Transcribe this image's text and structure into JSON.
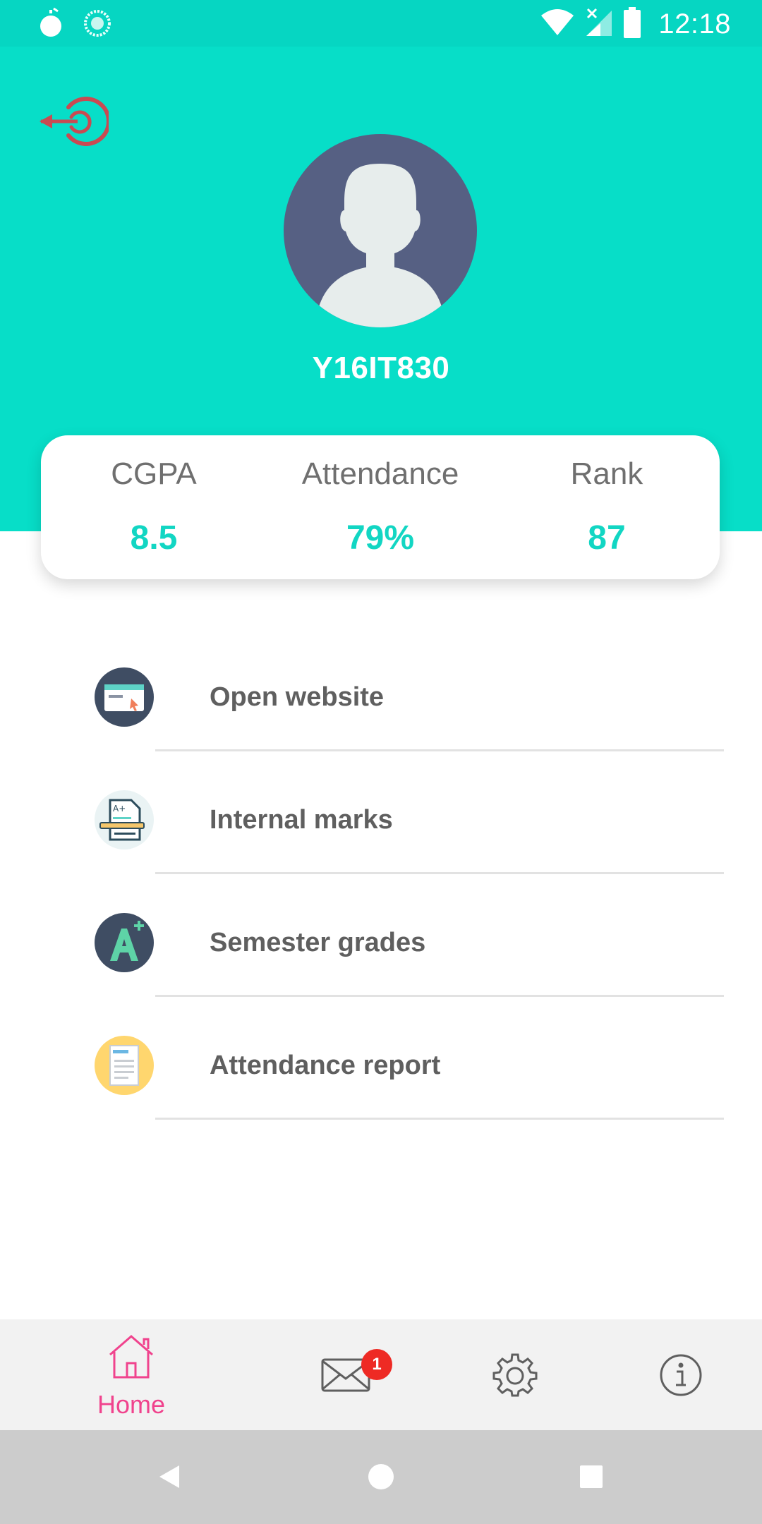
{
  "status_bar": {
    "time": "12:18",
    "left_icons": [
      "app-notification-icon",
      "sync-icon"
    ],
    "right_icons": [
      "wifi-icon",
      "no-signal-icon",
      "battery-icon"
    ]
  },
  "profile": {
    "student_id": "Y16IT830",
    "avatar_icon": "user-avatar-icon",
    "logout_icon": "logout-icon"
  },
  "stats": [
    {
      "label": "CGPA",
      "value": "8.5"
    },
    {
      "label": "Attendance",
      "value": "79%"
    },
    {
      "label": "Rank",
      "value": "87"
    }
  ],
  "menu": [
    {
      "label": "Open website",
      "icon": "website-browser-icon"
    },
    {
      "label": "Internal marks",
      "icon": "marks-document-icon"
    },
    {
      "label": "Semester grades",
      "icon": "grade-a-plus-icon"
    },
    {
      "label": "Attendance report",
      "icon": "report-icon"
    }
  ],
  "bottom_nav": {
    "home_label": "Home",
    "mail_badge": "1",
    "items": [
      "home-icon",
      "mail-icon",
      "settings-icon",
      "info-icon"
    ]
  },
  "colors": {
    "header": "#07DEC8",
    "accent_value": "#12D6C3",
    "active_nav": "#F0438D",
    "badge": "#EE2A24"
  }
}
